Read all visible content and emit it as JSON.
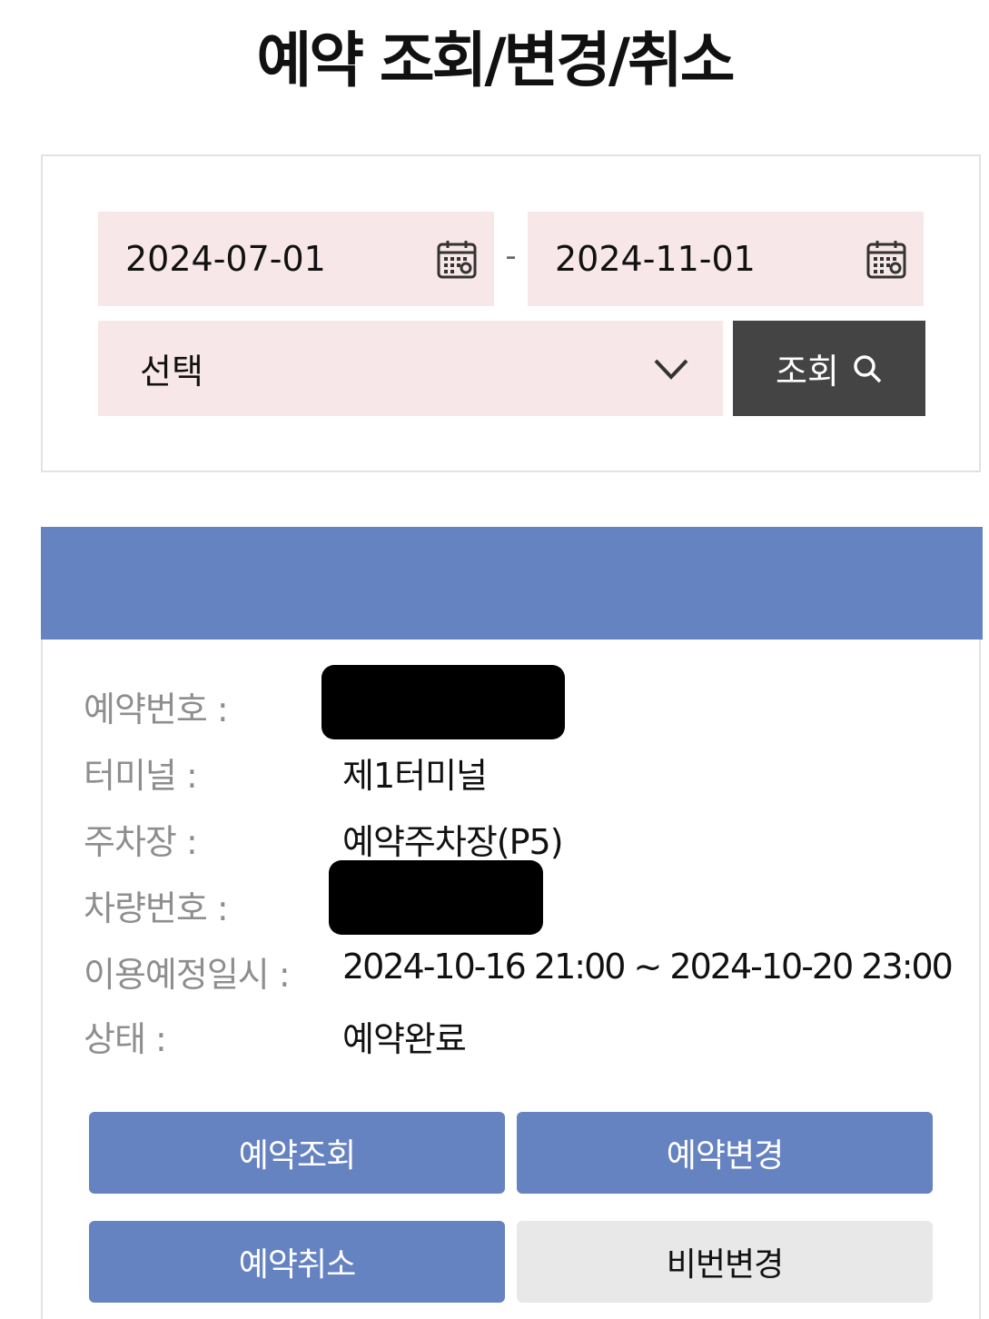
{
  "page": {
    "title": "예약 조회/변경/취소"
  },
  "search": {
    "start_date": "2024-07-01",
    "date_separator": "-",
    "end_date": "2024-11-01",
    "select_value": "선택",
    "search_label": "조회"
  },
  "reservation": {
    "number_label": "예약번호 :",
    "terminal_label": "터미널 :",
    "terminal_value": "제1터미널",
    "parking_label": "주차장 :",
    "parking_value": "예약주차장(P5)",
    "vehicle_label": "차량번호 :",
    "period_label": "이용예정일시 :",
    "period_value": "2024-10-16 21:00 ~ 2024-10-20 23:00",
    "status_label": "상태 :",
    "status_value": "예약완료"
  },
  "actions": {
    "view_label": "예약조회",
    "change_label": "예약변경",
    "cancel_label": "예약취소",
    "password_label": "비번변경"
  },
  "colors": {
    "accent": "#6582c1",
    "field_bg": "#f8e7e8",
    "search_btn_bg": "#444444",
    "gray_btn_bg": "#e8e8e8"
  }
}
